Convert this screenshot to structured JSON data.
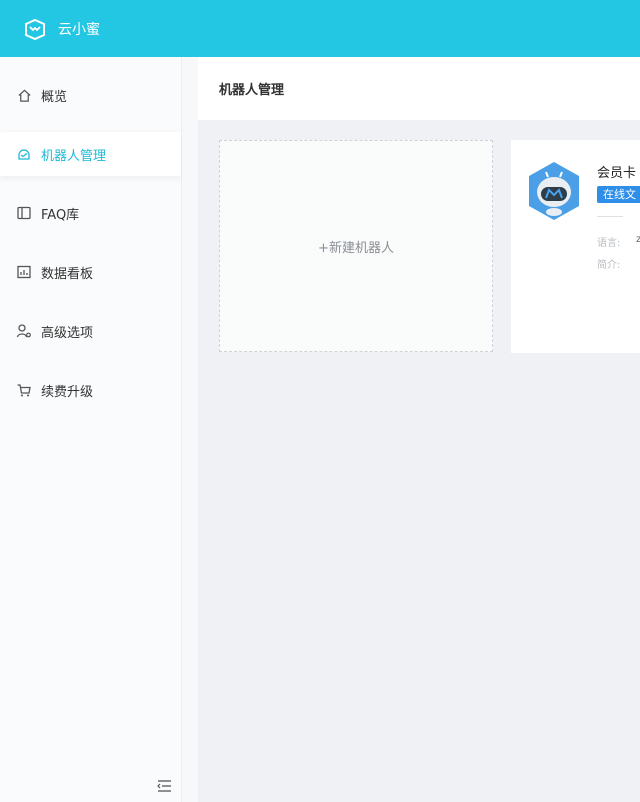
{
  "app": {
    "name": "云小蜜",
    "brand_color": "#23c6e3"
  },
  "sidebar": {
    "items": [
      {
        "label": "概览",
        "icon": "home-icon"
      },
      {
        "label": "机器人管理",
        "icon": "robot-icon",
        "active": true
      },
      {
        "label": "FAQ库",
        "icon": "book-icon"
      },
      {
        "label": "数据看板",
        "icon": "dashboard-icon"
      },
      {
        "label": "高级选项",
        "icon": "advanced-options-icon"
      },
      {
        "label": "续费升级",
        "icon": "cart-icon"
      }
    ],
    "collapse_icon": "collapse-menu-icon"
  },
  "page": {
    "title": "机器人管理"
  },
  "new_robot": {
    "label": "+新建机器人"
  },
  "bot_card": {
    "name": "会员卡",
    "tag": "在线文",
    "language_label": "语言:",
    "language_value": "z",
    "description_label": "简介:",
    "tag_color": "#2f8fe8"
  }
}
